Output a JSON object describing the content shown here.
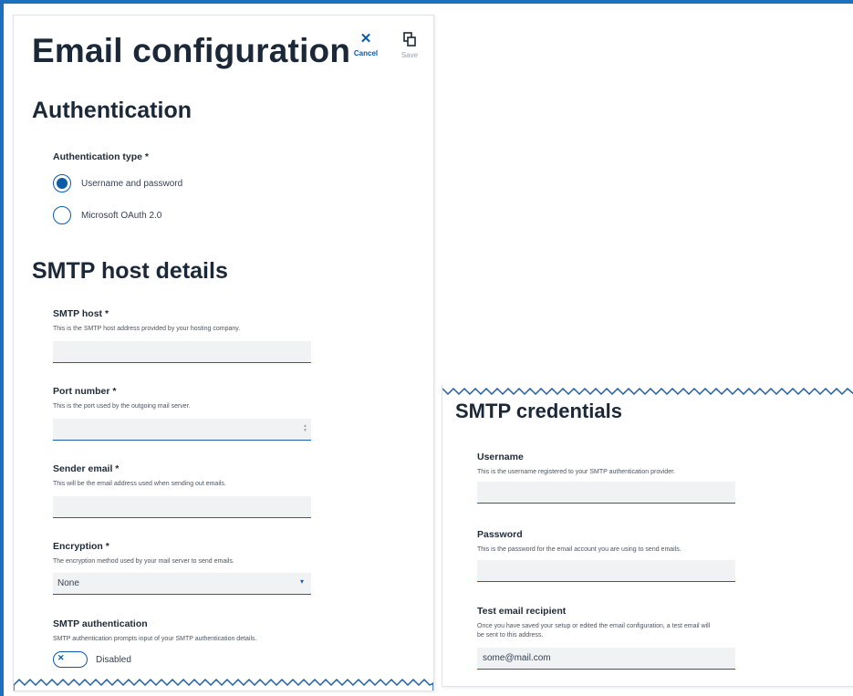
{
  "header": {
    "title": "Email configuration",
    "cancel_label": "Cancel",
    "cancel_icon": "close-icon",
    "save_label": "Save",
    "save_icon": "save-icon"
  },
  "authentication": {
    "title": "Authentication",
    "type_label": "Authentication type *",
    "options": [
      {
        "label": "Username and password",
        "selected": true
      },
      {
        "label": "Microsoft OAuth 2.0",
        "selected": false
      }
    ]
  },
  "smtp_host_details": {
    "title": "SMTP host details",
    "host": {
      "label": "SMTP host *",
      "help": "This is the SMTP host address provided by your hosting company.",
      "value": ""
    },
    "port": {
      "label": "Port number *",
      "help": "This is the port used by the outgoing mail server.",
      "value": ""
    },
    "sender": {
      "label": "Sender email *",
      "help": "This will be the email address used when sending out emails.",
      "value": ""
    },
    "encryption": {
      "label": "Encryption *",
      "help": "The encryption method used by your mail server to send emails.",
      "value": "None"
    },
    "smtp_auth": {
      "label": "SMTP authentication",
      "help": "SMTP authentication prompts input of your SMTP authentication details.",
      "toggle_label": "Disabled",
      "enabled": false
    }
  },
  "smtp_credentials": {
    "title": "SMTP credentials",
    "username": {
      "label": "Username",
      "help": "This is the username registered to your SMTP authentication provider.",
      "value": ""
    },
    "password": {
      "label": "Password",
      "help": "This is the password for the email account you are using to send emails.",
      "value": ""
    },
    "test_recipient": {
      "label": "Test email recipient",
      "help_line1": "Once you have saved your setup or edited the email configuration, a test email will",
      "help_line2": "be sent to this address.",
      "value": "some@mail.com"
    }
  },
  "colors": {
    "accent": "#0a5aa8",
    "frame": "#1f6fbf",
    "input_bg": "#f1f2f4",
    "disabled": "#9aa3ad"
  }
}
